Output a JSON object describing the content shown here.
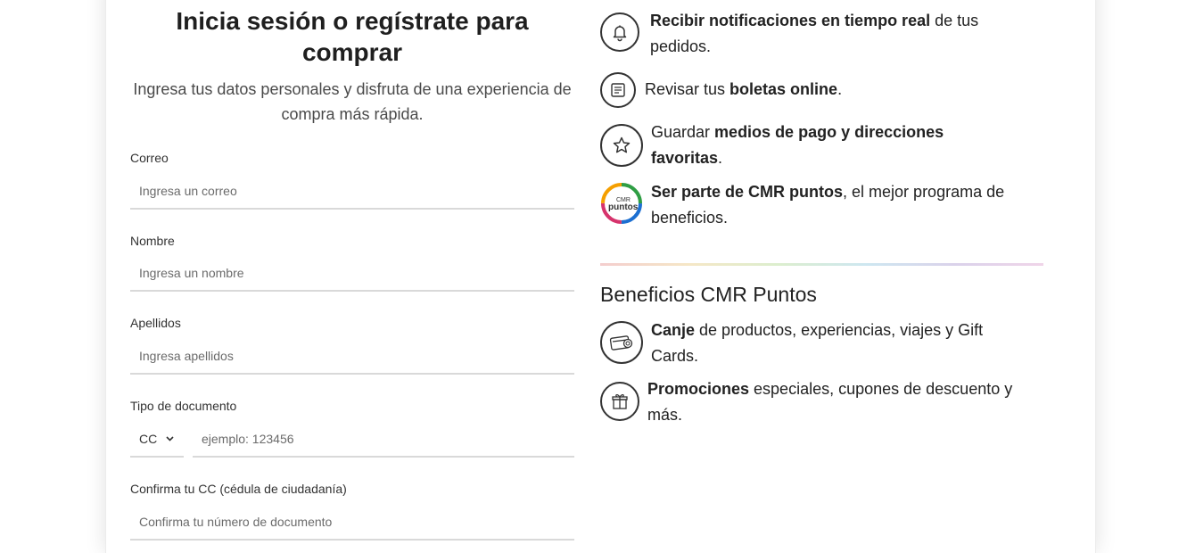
{
  "login": {
    "title": "Inicia sesión o regístrate para comprar",
    "subtitle": "Ingresa tus datos personales y disfruta de una experiencia de compra más rápida.",
    "email_label": "Correo",
    "email_placeholder": "Ingresa un correo",
    "name_label": "Nombre",
    "name_placeholder": "Ingresa un nombre",
    "lastname_label": "Apellidos",
    "lastname_placeholder": "Ingresa apellidos",
    "doctype_label": "Tipo de documento",
    "doctype_value": "CC",
    "docnumber_placeholder": "ejemplo: 123456",
    "confirm_label": "Confirma tu CC (cédula de ciudadanía)",
    "confirm_placeholder": "Confirma tu número de documento"
  },
  "benefits": [
    {
      "icon": "bell-icon",
      "bold": "Recibir notificaciones en tiempo real",
      "pre": "",
      "post": " de tus pedidos."
    },
    {
      "icon": "receipt-icon",
      "pre": "Revisar tus ",
      "bold": "boletas online",
      "post": "."
    },
    {
      "icon": "star-icon",
      "pre": "Guardar ",
      "bold": "medios de pago y direcciones favoritas",
      "post": "."
    },
    {
      "icon": "cmr-puntos-logo",
      "pre": "",
      "bold": "Ser parte de CMR puntos",
      "post": ", el mejor programa de beneficios."
    }
  ],
  "cmr_logo_text": {
    "top": "CMR",
    "bottom": "puntos"
  },
  "cmr_section": {
    "title": "Beneficios CMR Puntos",
    "items": [
      {
        "icon": "card-exchange-icon",
        "pre": "",
        "bold": "Canje",
        "post": " de productos, experiencias, viajes y Gift Cards."
      },
      {
        "icon": "gift-icon",
        "pre": "",
        "bold": "Promociones",
        "post": " especiales, cupones de descuento y más."
      }
    ]
  }
}
